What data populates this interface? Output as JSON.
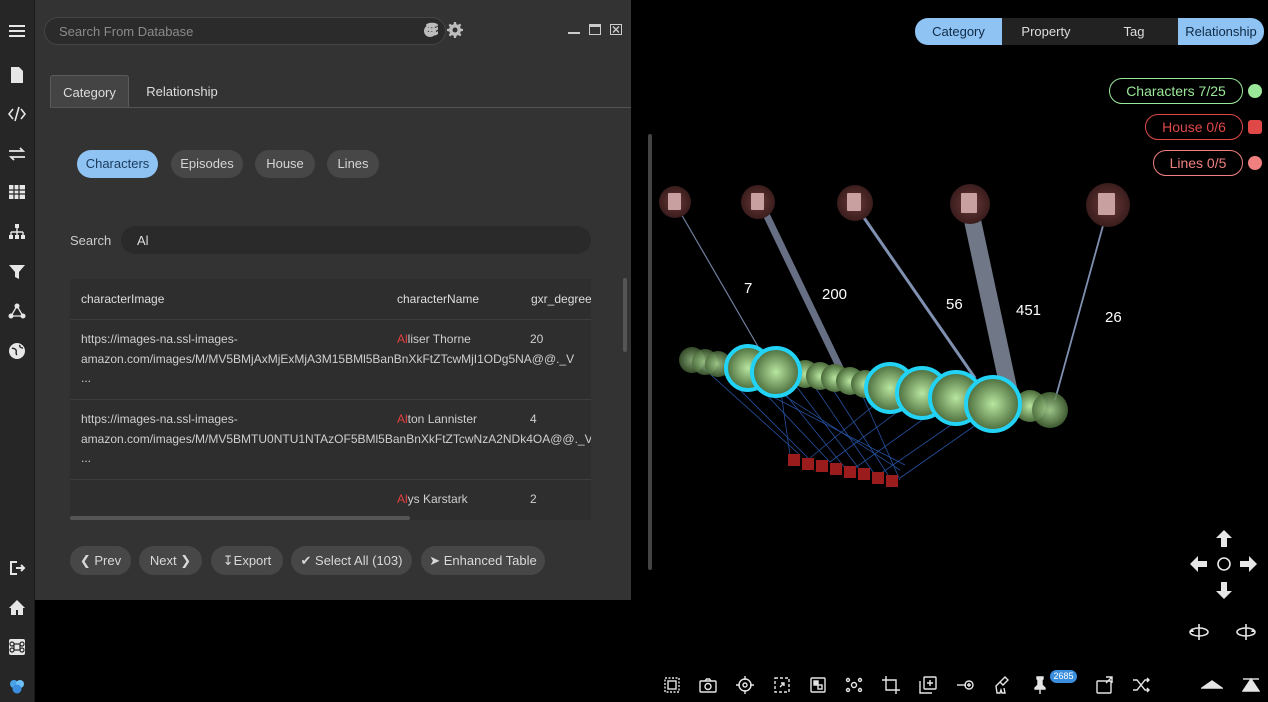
{
  "sidebar": {
    "items": [
      "menu-icon",
      "file-icon",
      "code-icon",
      "transfer-icon",
      "table-icon",
      "hierarchy-icon",
      "filter-icon",
      "network-icon",
      "globe-icon",
      "logout-icon",
      "home-icon",
      "command-icon",
      "app-logo-icon"
    ]
  },
  "db_panel": {
    "search_placeholder": "Search From Database",
    "tabs": [
      {
        "label": "Category"
      },
      {
        "label": "Relationship"
      }
    ],
    "categories": [
      {
        "label": "Characters"
      },
      {
        "label": "Episodes"
      },
      {
        "label": "House"
      },
      {
        "label": "Lines"
      }
    ],
    "search_label": "Search",
    "search_value": "Al",
    "columns": [
      "characterImage",
      "characterName",
      "gxr_degree"
    ],
    "rows": [
      {
        "image": "https://images-na.ssl-images-amazon.com/images/M/MV5BMjAxMjExMjA3M15BMl5BanBnXkFtZTcwMjI1ODg5NA@@._V ...",
        "name_match": "Al",
        "name_rest": "liser Thorne",
        "degree": "20"
      },
      {
        "image": "https://images-na.ssl-images-amazon.com/images/M/MV5BMTU0NTU1NTAzOF5BMl5BanBnXkFtZTcwNzA2NDk4OA@@._V ...",
        "name_match": "Al",
        "name_rest": "ton Lannister",
        "degree": "4"
      },
      {
        "image": "",
        "name_match": "Al",
        "name_rest": "ys Karstark",
        "degree": "2"
      }
    ],
    "buttons": {
      "prev": "Prev",
      "next": "Next",
      "export": "Export",
      "select_all": "Select All (103)",
      "enhanced": "Enhanced Table"
    }
  },
  "graph": {
    "view_tabs": [
      {
        "label": "Category"
      },
      {
        "label": "Property"
      },
      {
        "label": "Tag"
      },
      {
        "label": "Relationship"
      }
    ],
    "legend": [
      {
        "label": "Characters 7/25",
        "color": "#9be89b"
      },
      {
        "label": "House 0/6",
        "color": "#e04848"
      },
      {
        "label": "Lines 0/5",
        "color": "#f08080"
      }
    ],
    "edge_labels": [
      "7",
      "200",
      "56",
      "451",
      "26"
    ],
    "pin_count": "2685"
  },
  "colors": {
    "accent": "#8ec3f3",
    "highlight": "#e04040",
    "node_glow": "#22d3f5"
  }
}
